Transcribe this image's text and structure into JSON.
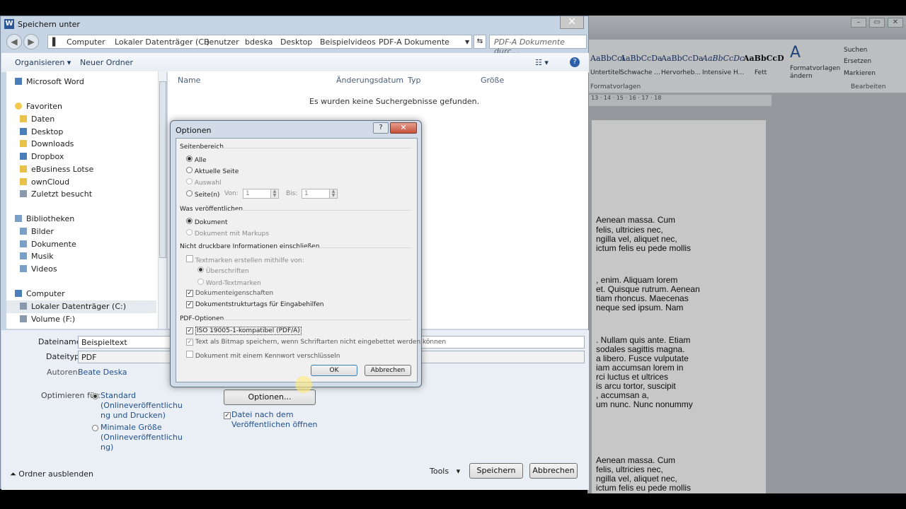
{
  "word": {
    "styles": [
      {
        "sample": "AaBbCcI",
        "name": "Untertitel"
      },
      {
        "sample": "AaBbCcDa",
        "name": "Schwache ..."
      },
      {
        "sample": "AaBbCcDa",
        "name": "Hervorheb..."
      },
      {
        "sample": "AaBbCcDc",
        "name": "Intensive H..."
      },
      {
        "sample": "AaBbCcD",
        "name": "Fett"
      }
    ],
    "formatvorlagen": "Formatvorlagen ändern",
    "group_vorlagen": "Formatvorlagen",
    "edit": {
      "suchen": "Suchen",
      "ersetzen": "Ersetzen",
      "markieren": "Markieren",
      "group": "Bearbeiten"
    },
    "ruler": "· 13 · 14 · 15 · 16 · 17 · 18",
    "paragraphs": [
      [
        "Aenean massa. Cum",
        "felis, ultricies nec,",
        "ngilla vel, aliquet nec,",
        "ictum felis eu pede mollis"
      ],
      [
        ", enim. Aliquam lorem",
        "et. Quisque rutrum. Aenean",
        "tiam rhoncus. Maecenas",
        "neque sed ipsum. Nam"
      ],
      [
        ". Nullam quis ante. Etiam",
        "sodales sagittis magna.",
        "a libero. Fusce vulputate",
        "iam accumsan lorem in",
        "rci luctus et ultrices",
        "is arcu tortor, suscipit",
        ", accumsan a,",
        "um nunc. Nunc nonummy"
      ],
      [
        "Aenean massa. Cum",
        "felis, ultricies nec,",
        "ngilla vel, aliquet nec,",
        "ictum felis eu pede mollis"
      ]
    ]
  },
  "save": {
    "title": "Speichern unter",
    "address": [
      "Computer",
      "Lokaler Datenträger (C:)",
      "Benutzer",
      "bdeska",
      "Desktop",
      "Beispielvideos",
      "PDF-A Dokumente"
    ],
    "search_placeholder": "PDF-A Dokumente durc...",
    "toolbar": {
      "organize": "Organisieren ▾",
      "new_folder": "Neuer Ordner"
    },
    "nav": [
      {
        "label": "Microsoft Word",
        "icon": "word-icon"
      },
      {
        "label": "Favoriten",
        "icon": "star-icon"
      },
      {
        "label": "Daten",
        "icon": "folder-icon"
      },
      {
        "label": "Desktop",
        "icon": "desktop-icon"
      },
      {
        "label": "Downloads",
        "icon": "downloads-icon"
      },
      {
        "label": "Dropbox",
        "icon": "dropbox-icon"
      },
      {
        "label": "eBusiness Lotse",
        "icon": "folder-icon"
      },
      {
        "label": "ownCloud",
        "icon": "folder-icon"
      },
      {
        "label": "Zuletzt besucht",
        "icon": "recent-icon"
      },
      {
        "label": "Bibliotheken",
        "icon": "library-icon"
      },
      {
        "label": "Bilder",
        "icon": "pictures-icon"
      },
      {
        "label": "Dokumente",
        "icon": "documents-icon"
      },
      {
        "label": "Musik",
        "icon": "music-icon"
      },
      {
        "label": "Videos",
        "icon": "videos-icon"
      },
      {
        "label": "Computer",
        "icon": "computer-icon"
      },
      {
        "label": "Lokaler Datenträger (C:)",
        "icon": "drive-icon"
      },
      {
        "label": "Volume (F:)",
        "icon": "drive-icon"
      }
    ],
    "columns": [
      "Name",
      "Änderungsdatum",
      "Typ",
      "Größe"
    ],
    "empty": "Es wurden keine Suchergebnisse gefunden.",
    "filename_label": "Dateiname:",
    "filename": "Beispieltext",
    "filetype_label": "Dateityp:",
    "filetype": "PDF",
    "authors_label": "Autoren:",
    "authors": "Beate Deska",
    "optimize_label": "Optimieren für:",
    "opt_standard": [
      "Standard",
      "(Onlineveröffentlichu",
      "ng und Drucken)"
    ],
    "opt_min": [
      "Minimale Größe",
      "(Onlineveröffentlichu",
      "ng)"
    ],
    "options_button": "Optionen...",
    "open_after": [
      "Datei nach dem",
      "Veröffentlichen öffnen"
    ],
    "hide_folders": "Ordner ausblenden",
    "tools": "Tools",
    "save_button": "Speichern",
    "cancel_button": "Abbrechen"
  },
  "options": {
    "title": "Optionen",
    "help": "?",
    "close": "✕",
    "range_header": "Seitenbereich",
    "range": [
      "Alle",
      "Aktuelle Seite",
      "Auswahl",
      "Seite(n)"
    ],
    "von": "Von:",
    "bis": "Bis:",
    "von_value": "1",
    "bis_value": "1",
    "publish_header": "Was veröffentlichen",
    "publish": [
      "Dokument",
      "Dokument mit Markups"
    ],
    "nonprint_header": "Nicht druckbare Informationen einschließen",
    "bookmarks": "Textmarken erstellen mithilfe von:",
    "headings": "Überschriften",
    "word_bookmarks": "Word-Textmarken",
    "doc_props": "Dokumenteigenschaften",
    "struct_tags": "Dokumentstrukturtags für Eingabehilfen",
    "pdf_header": "PDF-Optionen",
    "iso": "ISO 19005-1-kompatibel (PDF/A)",
    "bitmap": "Text als Bitmap speichern, wenn Schriftarten nicht eingebettet werden können",
    "encrypt": "Dokument mit einem Kennwort verschlüsseln",
    "ok": "OK",
    "cancel": "Abbrechen"
  }
}
